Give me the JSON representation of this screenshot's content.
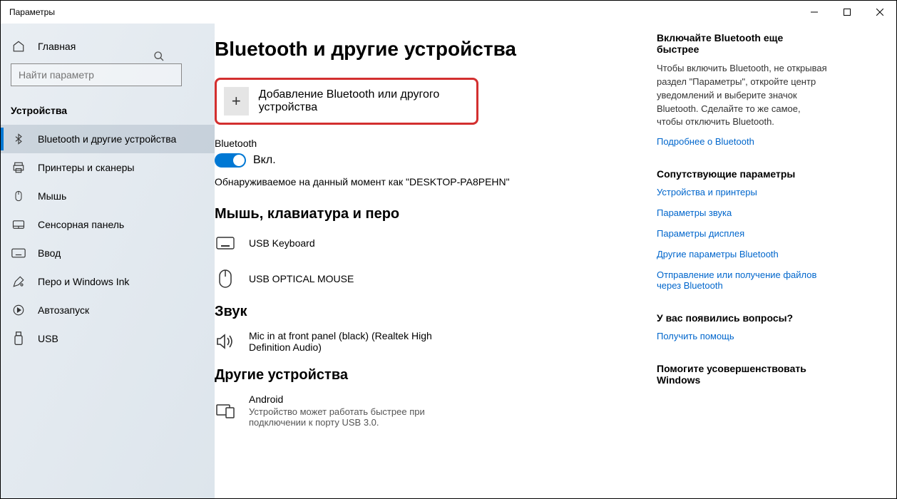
{
  "window": {
    "title": "Параметры"
  },
  "sidebar": {
    "home": "Главная",
    "search_placeholder": "Найти параметр",
    "category": "Устройства",
    "items": [
      "Bluetooth и другие устройства",
      "Принтеры и сканеры",
      "Мышь",
      "Сенсорная панель",
      "Ввод",
      "Перо и Windows Ink",
      "Автозапуск",
      "USB"
    ]
  },
  "page": {
    "title": "Bluetooth и другие устройства",
    "add_label": "Добавление Bluetooth или другого устройства",
    "bt_label": "Bluetooth",
    "bt_state": "Вкл.",
    "discover": "Обнаруживаемое на данный момент как \"DESKTOP-PA8PEHN\"",
    "sec_mouse": "Мышь, клавиатура и перо",
    "dev_kbd": "USB Keyboard",
    "dev_mouse": "USB OPTICAL MOUSE",
    "sec_sound": "Звук",
    "dev_mic": "Mic in at front panel (black) (Realtek High Definition Audio)",
    "sec_other": "Другие устройства",
    "dev_android": "Android",
    "dev_android_sub": "Устройство может работать быстрее при подключении к порту USB 3.0."
  },
  "right": {
    "tip_title": "Включайте Bluetooth еще быстрее",
    "tip_body": "Чтобы включить Bluetooth, не открывая раздел \"Параметры\", откройте центр уведомлений и выберите значок Bluetooth. Сделайте то же самое, чтобы отключить Bluetooth.",
    "tip_link": "Подробнее о Bluetooth",
    "related_title": "Сопутствующие параметры",
    "links": [
      "Устройства и принтеры",
      "Параметры звука",
      "Параметры дисплея",
      "Другие параметры Bluetooth",
      "Отправление или получение файлов через Bluetooth"
    ],
    "q_title": "У вас появились вопросы?",
    "q_link": "Получить помощь",
    "improve_title": "Помогите усовершенствовать Windows"
  }
}
